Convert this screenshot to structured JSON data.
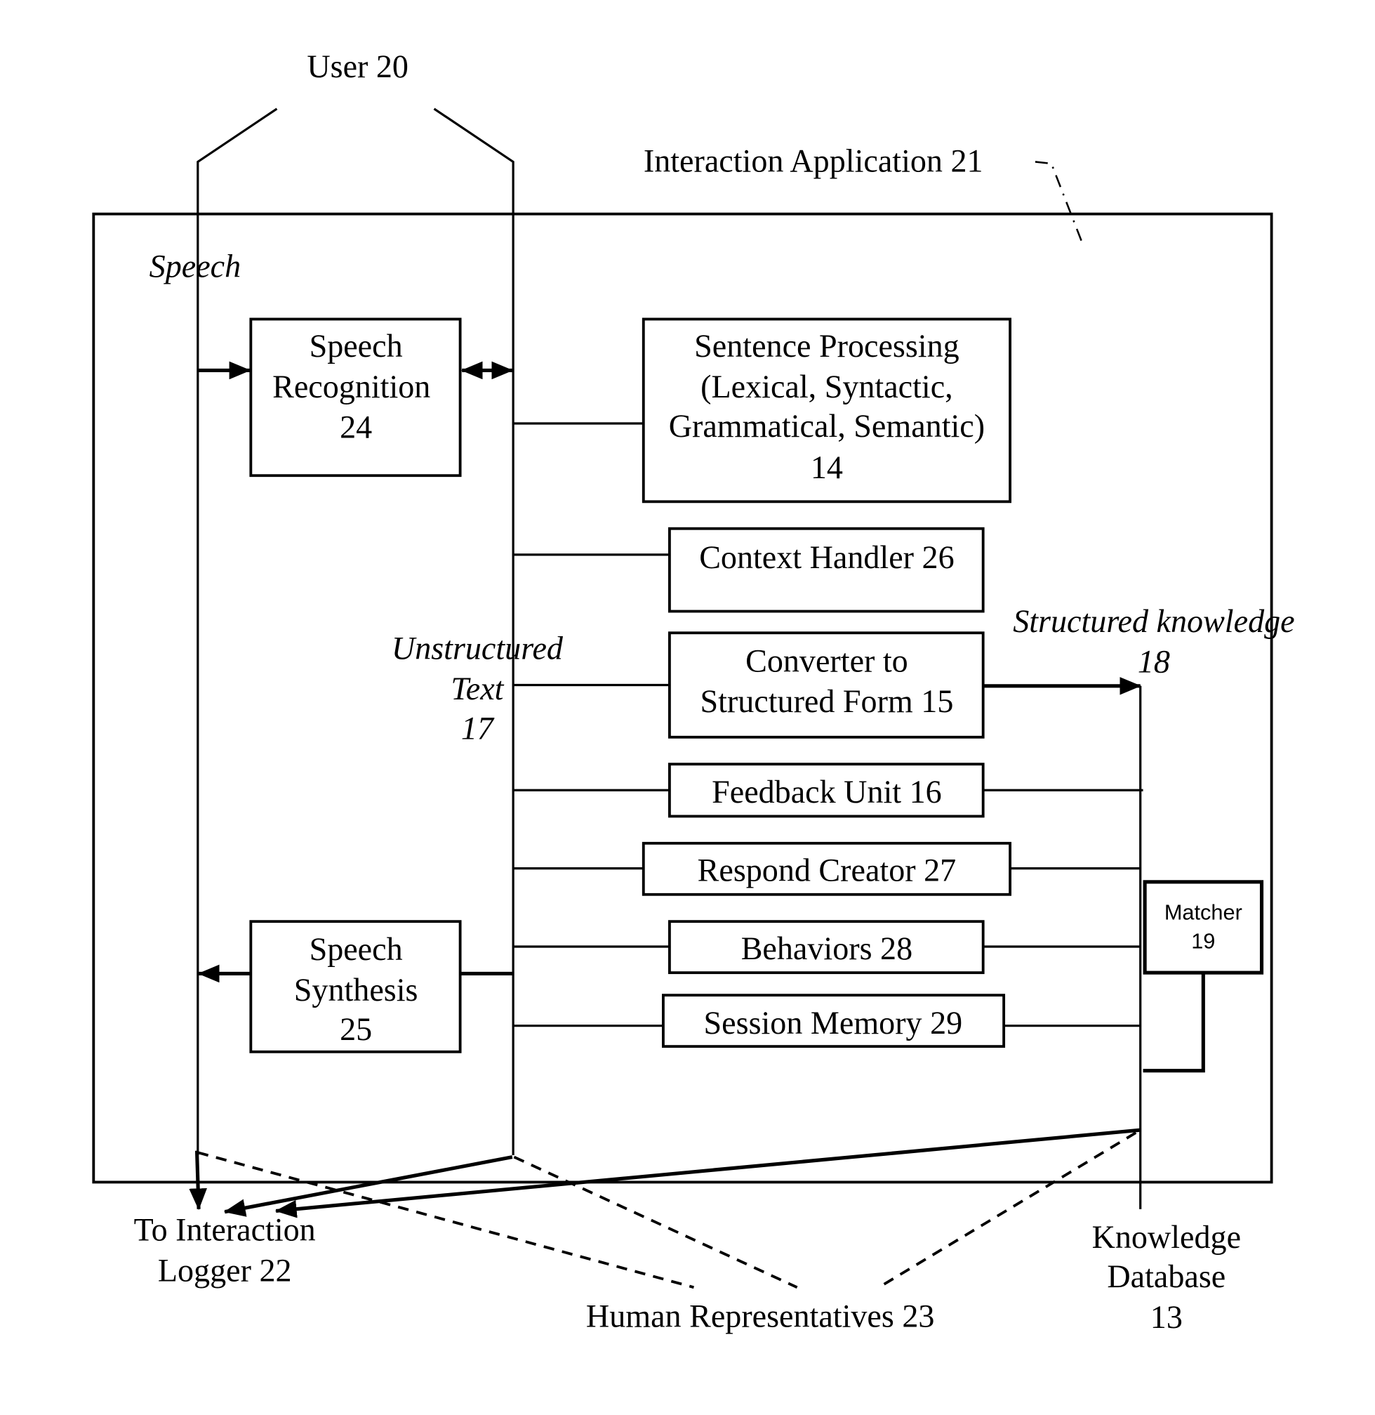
{
  "labels": {
    "user": "User 20",
    "app": "Interaction Application 21",
    "speech": "Speech",
    "unstructured": [
      "Unstructured",
      "Text",
      "17"
    ],
    "structured_knowledge": [
      "Structured knowledge",
      "18"
    ],
    "logger": [
      "To Interaction",
      "Logger 22"
    ],
    "human_reps": "Human Representatives 23",
    "kdb": [
      "Knowledge",
      "Database",
      "13"
    ]
  },
  "boxes": {
    "speech_recognition": [
      "Speech",
      "Recognition",
      "24"
    ],
    "sentence_processing": [
      "Sentence Processing",
      "(Lexical, Syntactic,",
      "Grammatical, Semantic)",
      "14"
    ],
    "context_handler": [
      "Context Handler 26"
    ],
    "converter": [
      "Converter to",
      "Structured Form 15"
    ],
    "feedback": [
      "Feedback Unit 16"
    ],
    "respond": [
      "Respond Creator 27"
    ],
    "behaviors": [
      "Behaviors 28"
    ],
    "session": [
      "Session Memory 29"
    ],
    "speech_synthesis": [
      "Speech",
      "Synthesis",
      "25"
    ],
    "matcher": [
      "Matcher",
      "19"
    ]
  }
}
